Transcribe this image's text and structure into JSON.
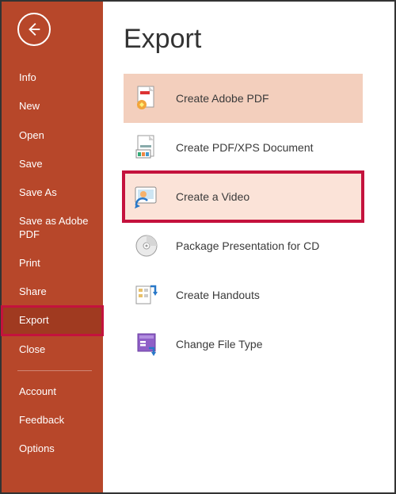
{
  "sidebar": {
    "items": [
      {
        "label": "Info"
      },
      {
        "label": "New"
      },
      {
        "label": "Open"
      },
      {
        "label": "Save"
      },
      {
        "label": "Save As"
      },
      {
        "label": "Save as Adobe PDF"
      },
      {
        "label": "Print"
      },
      {
        "label": "Share"
      },
      {
        "label": "Export",
        "selected": true,
        "highlighted": true
      },
      {
        "label": "Close"
      }
    ],
    "lower_items": [
      {
        "label": "Account"
      },
      {
        "label": "Feedback"
      },
      {
        "label": "Options"
      }
    ]
  },
  "main": {
    "title": "Export",
    "options": [
      {
        "label": "Create Adobe PDF",
        "icon": "adobe-pdf-icon",
        "selected": true
      },
      {
        "label": "Create PDF/XPS Document",
        "icon": "pdf-xps-icon"
      },
      {
        "label": "Create a Video",
        "icon": "video-icon",
        "highlighted": true
      },
      {
        "label": "Package Presentation for CD",
        "icon": "cd-icon"
      },
      {
        "label": "Create Handouts",
        "icon": "handouts-icon"
      },
      {
        "label": "Change File Type",
        "icon": "filetype-icon"
      }
    ]
  }
}
